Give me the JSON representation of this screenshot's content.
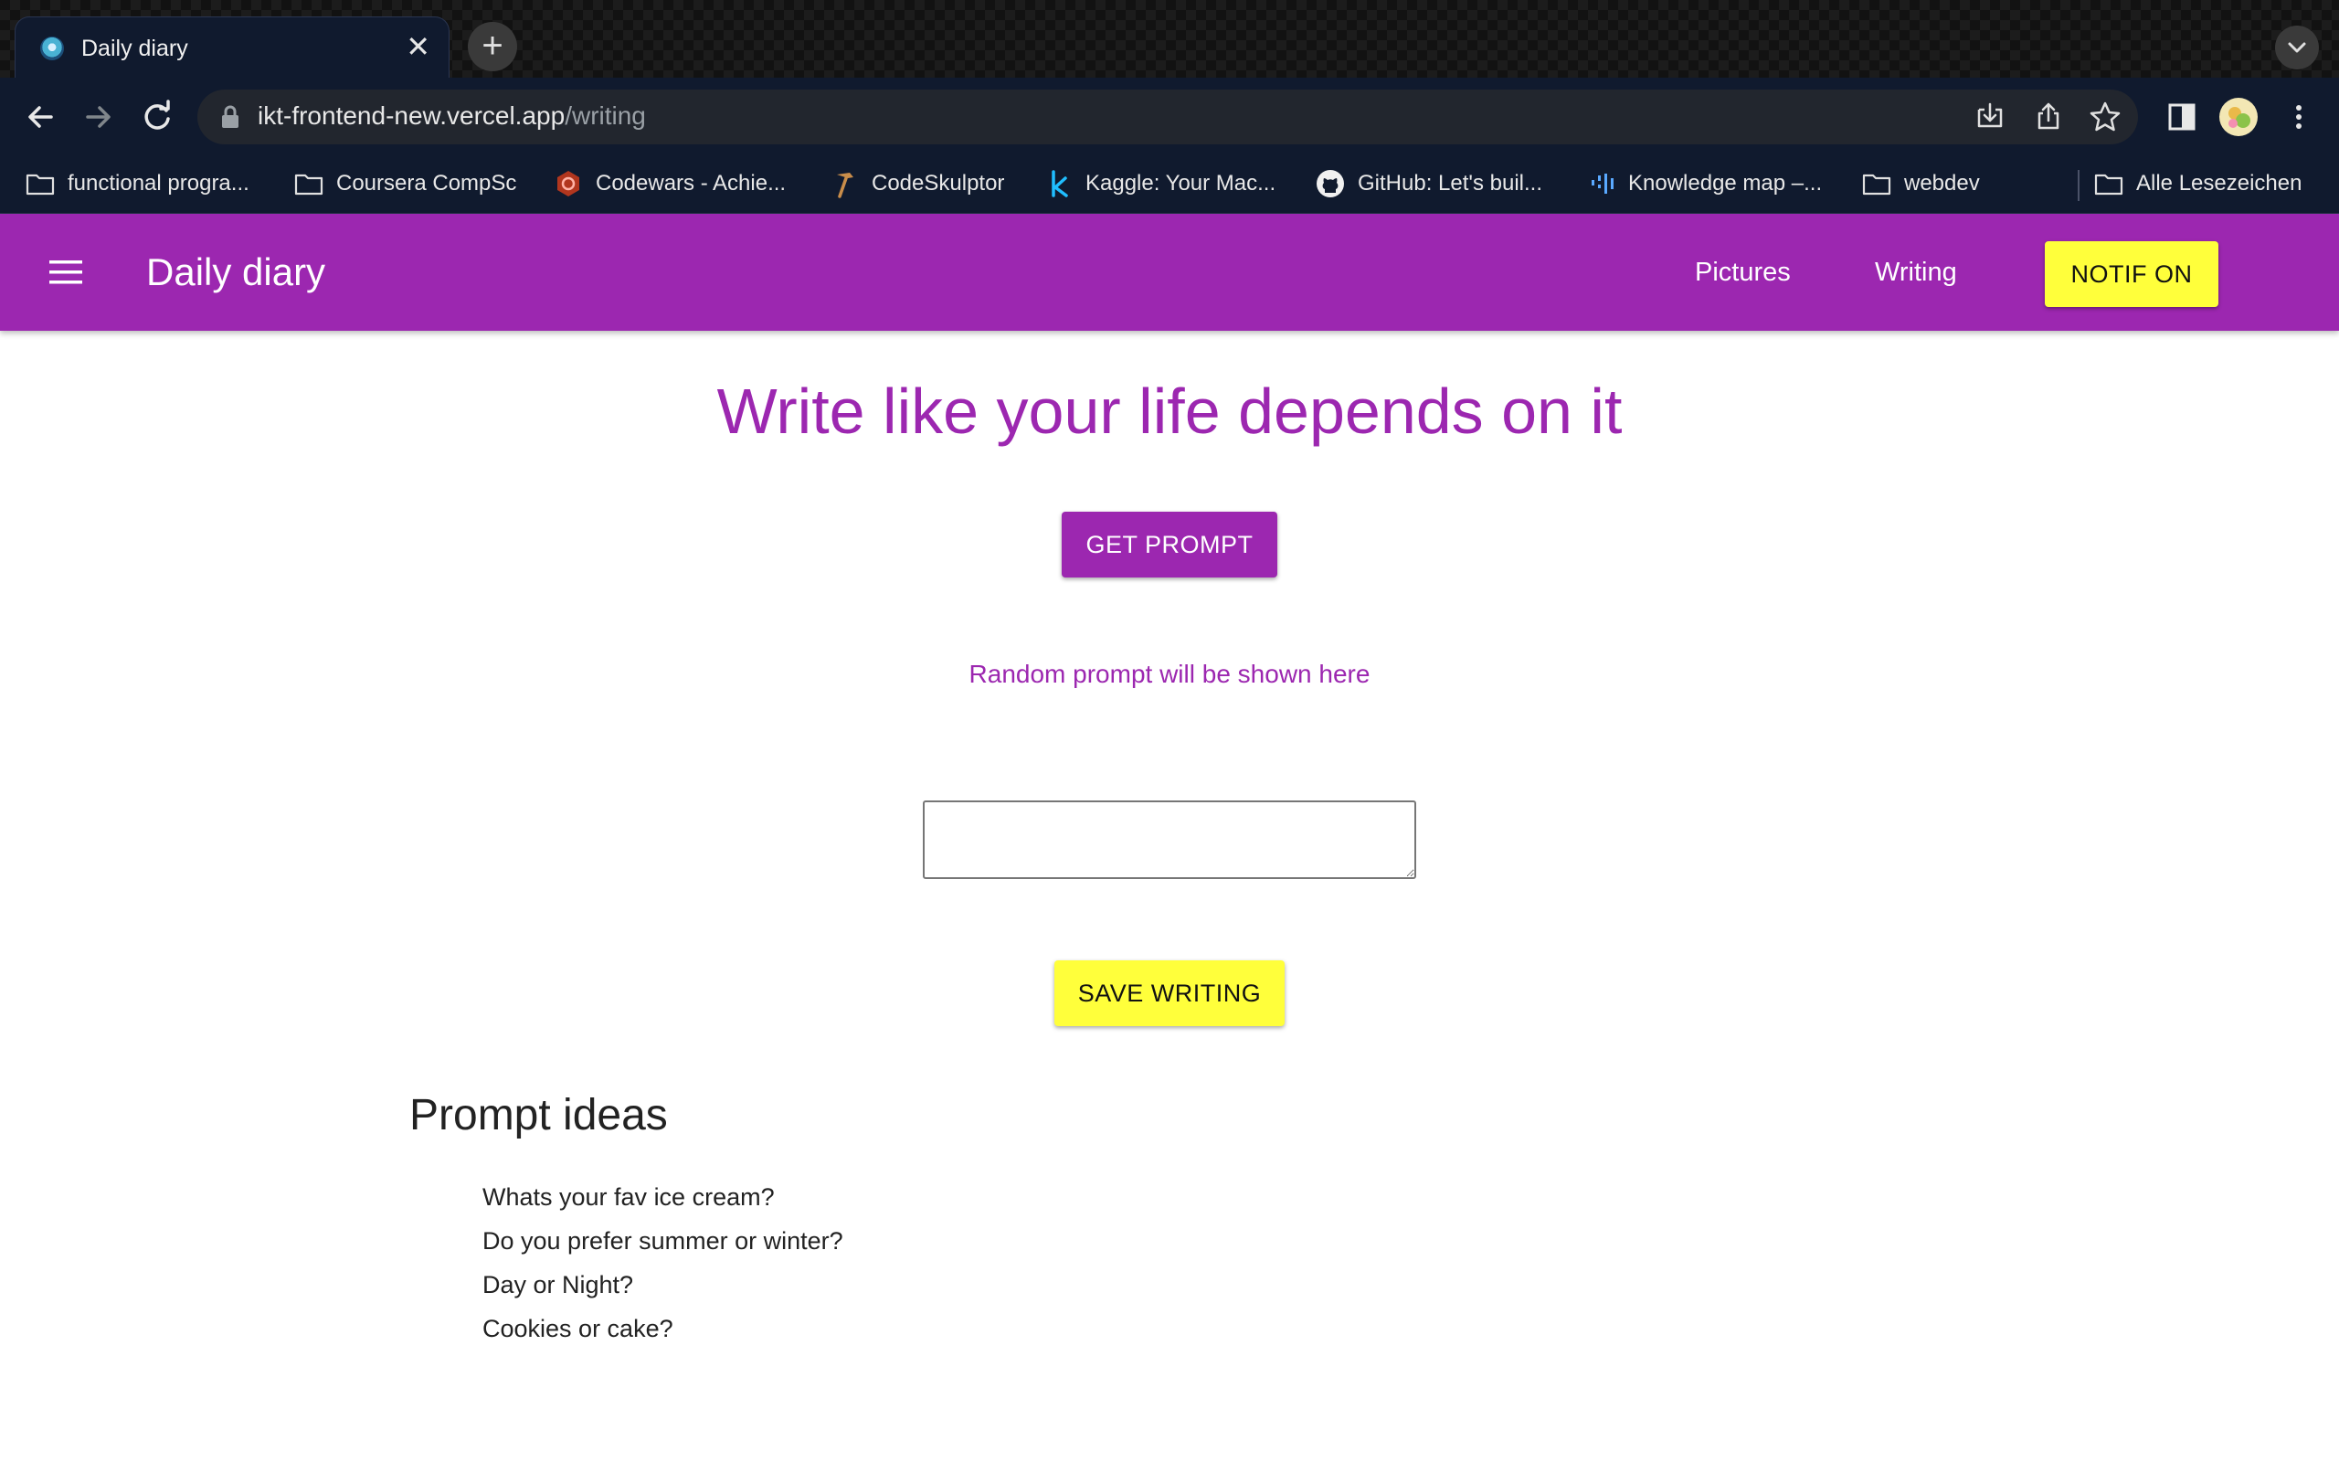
{
  "browser": {
    "tab_title": "Daily diary",
    "url_host": "ikt-frontend-new.vercel.app",
    "url_path": "/writing",
    "bookmarks": [
      {
        "label": "functional progra...",
        "icon": "folder-icon"
      },
      {
        "label": "Coursera CompSc",
        "icon": "folder-icon"
      },
      {
        "label": "Codewars - Achie...",
        "icon": "codewars-icon"
      },
      {
        "label": "CodeSkulptor",
        "icon": "hammer-icon"
      },
      {
        "label": "Kaggle: Your Mac...",
        "icon": "kaggle-icon"
      },
      {
        "label": "GitHub: Let's buil...",
        "icon": "github-icon"
      },
      {
        "label": "Knowledge map –...",
        "icon": "knowledge-map-icon"
      },
      {
        "label": "webdev",
        "icon": "folder-icon"
      }
    ],
    "all_bookmarks": "Alle Lesezeichen"
  },
  "app": {
    "title": "Daily diary",
    "nav": {
      "pictures": "Pictures",
      "writing": "Writing"
    },
    "notif_button": "NOTIF ON",
    "colors": {
      "primary": "#9c27b0",
      "accent": "#ffff3b"
    }
  },
  "main": {
    "heading": "Write like your life depends on it",
    "get_prompt_button": "GET PROMPT",
    "prompt_placeholder": "Random prompt will be shown here",
    "writing_value": "",
    "save_button": "SAVE WRITING",
    "ideas_title": "Prompt ideas",
    "ideas": [
      "Whats your fav ice cream?",
      "Do you prefer summer or winter?",
      "Day or Night?",
      "Cookies or cake?"
    ]
  }
}
